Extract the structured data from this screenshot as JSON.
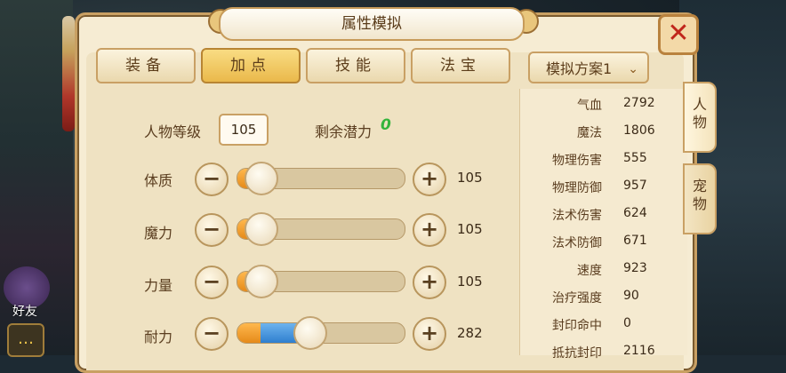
{
  "window": {
    "title": "属性模拟",
    "close_label": "✕"
  },
  "tabs": [
    {
      "label": "装备",
      "active": false
    },
    {
      "label": "加点",
      "active": true
    },
    {
      "label": "技能",
      "active": false
    },
    {
      "label": "法宝",
      "active": false
    }
  ],
  "scheme": {
    "label": "模拟方案1",
    "chevron": "⌄"
  },
  "level": {
    "label": "人物等级",
    "value": "105"
  },
  "remaining": {
    "label": "剩余潜力",
    "value": "0"
  },
  "attributes": [
    {
      "label": "体质",
      "value": "105",
      "fill": 0.14
    },
    {
      "label": "魔力",
      "value": "105",
      "fill": 0.14
    },
    {
      "label": "力量",
      "value": "105",
      "fill": 0.14
    },
    {
      "label": "耐力",
      "value": "282",
      "fill": 0.43,
      "added_from": 0.14
    }
  ],
  "stats": [
    {
      "name": "气血",
      "value": "2792"
    },
    {
      "name": "魔法",
      "value": "1806"
    },
    {
      "name": "物理伤害",
      "value": "555"
    },
    {
      "name": "物理防御",
      "value": "957"
    },
    {
      "name": "法术伤害",
      "value": "624"
    },
    {
      "name": "法术防御",
      "value": "671"
    },
    {
      "name": "速度",
      "value": "923"
    },
    {
      "name": "治疗强度",
      "value": "90"
    },
    {
      "name": "封印命中",
      "value": "0"
    },
    {
      "name": "抵抗封印",
      "value": "2116"
    }
  ],
  "side_tabs": [
    {
      "label": "人物",
      "active": true
    },
    {
      "label": "宠物",
      "active": false
    }
  ],
  "hud": {
    "friend_label": "好友",
    "chat_icon": "chat-icon"
  },
  "buttons": {
    "minus": "−",
    "plus": "+"
  }
}
